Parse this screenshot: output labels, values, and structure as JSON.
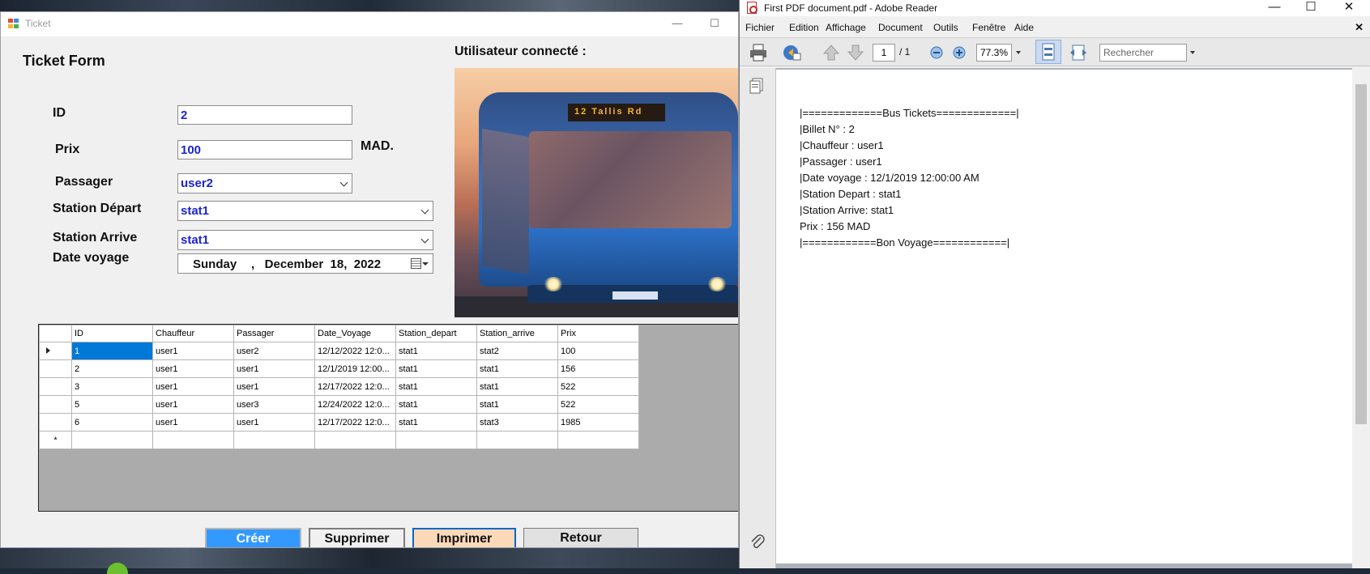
{
  "ticket_window": {
    "title": "Ticket",
    "form_title": "Ticket Form",
    "user_label": "Utilisateur connecté :",
    "fields": {
      "id_label": "ID",
      "id_value": "2",
      "prix_label": "Prix",
      "prix_value": "100",
      "currency": "MAD.",
      "passager_label": "Passager",
      "passager_value": "user2",
      "station_depart_label": "Station Départ",
      "station_depart_value": "stat1",
      "station_arrive_label": "Station Arrive",
      "station_arrive_value": "stat1",
      "date_label": "Date voyage",
      "date_day": "Sunday",
      "date_rest": ",   December  18,  2022"
    },
    "grid": {
      "columns": [
        "ID",
        "Chauffeur",
        "Passager",
        "Date_Voyage",
        "Station_depart",
        "Station_arrive",
        "Prix"
      ],
      "rows": [
        [
          "1",
          "user1",
          "user2",
          "12/12/2022 12:0...",
          "stat1",
          "stat2",
          "100"
        ],
        [
          "2",
          "user1",
          "user1",
          "12/1/2019 12:00...",
          "stat1",
          "stat1",
          "156"
        ],
        [
          "3",
          "user1",
          "user1",
          "12/17/2022 12:0...",
          "stat1",
          "stat1",
          "522"
        ],
        [
          "5",
          "user1",
          "user3",
          "12/24/2022 12:0...",
          "stat1",
          "stat1",
          "522"
        ],
        [
          "6",
          "user1",
          "user1",
          "12/17/2022 12:0...",
          "stat1",
          "stat3",
          "1985"
        ]
      ],
      "new_row_marker": "*"
    },
    "buttons": {
      "creer": "Créer",
      "supprimer": "Supprimer",
      "imprimer": "Imprimer",
      "retour": "Retour"
    },
    "bus_sign": "12  Tallis Rd"
  },
  "adobe_window": {
    "title": "First PDF document.pdf - Adobe Reader",
    "menu": [
      "Fichier",
      "Edition",
      "Affichage",
      "Document",
      "Outils",
      "Fenêtre",
      "Aide"
    ],
    "page_current": "1",
    "page_total": "/ 1",
    "zoom": "77.3%",
    "search_placeholder": "Rechercher",
    "pdf_lines": [
      "|=============Bus Tickets=============|",
      "|Billet N° : 2",
      "|Chauffeur : user1",
      "|Passager : user1",
      "|Date voyage : 12/1/2019 12:00:00 AM",
      "|Station Depart : stat1",
      "|Station Arrive: stat1",
      "Prix : 156 MAD",
      "|============Bon Voyage============|"
    ]
  },
  "colors": {
    "input_text": "#1c24d0",
    "creer_button": "#3399ff",
    "imprimer_button": "#fcd9b8",
    "selection": "#0078d7"
  }
}
